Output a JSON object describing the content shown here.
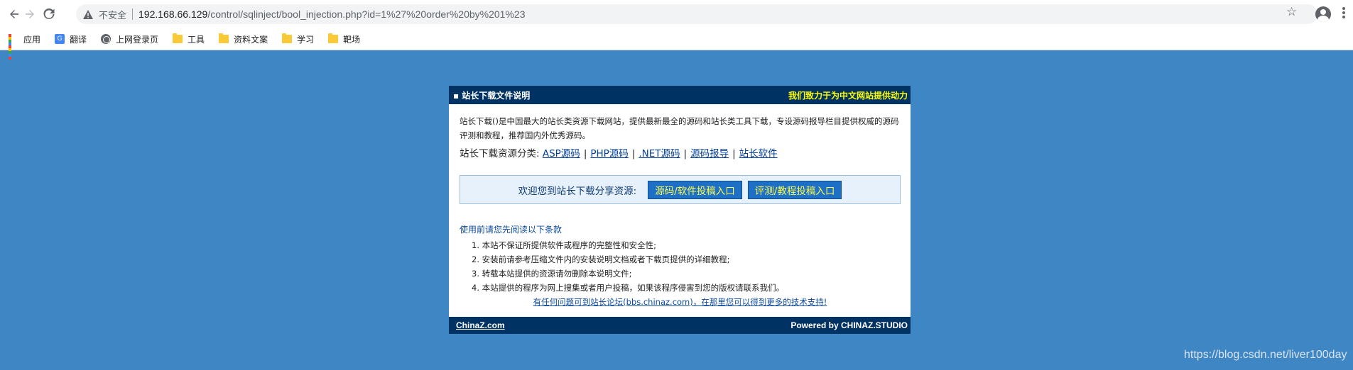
{
  "browser": {
    "security_label": "不安全",
    "url_host": "192.168.66.129",
    "url_path": "/control/sqlinject/bool_injection.php?id=1%27%20order%20by%201%23",
    "bookmarks": [
      "应用",
      "翻译",
      "上网登录页",
      "工具",
      "资料文案",
      "学习",
      "靶场"
    ],
    "icons": [
      "back-icon",
      "forward-icon",
      "reload-icon",
      "warning-icon",
      "star-icon",
      "account-icon",
      "menu-icon"
    ]
  },
  "panel": {
    "title": "▪ 站长下载文件说明",
    "slogan": "我们致力于为中文网站提供动力",
    "intro": "站长下载()是中国最大的站长类资源下载网站，提供最新最全的源码和站长类工具下载，专设源码报导栏目提供权威的源码评测和教程，推荐国内外优秀源码。",
    "category_label": "站长下载资源分类:",
    "categories": [
      "ASP源码",
      "PHP源码",
      ".NET源码",
      "源码报导",
      "站长软件"
    ],
    "share_text": "欢迎您到站长下载分享资源:",
    "share_buttons": [
      "源码/软件投稿入口",
      "评测/教程投稿入口"
    ],
    "terms_heading": "使用前请您先阅读以下条款",
    "terms": [
      "1. 本站不保证所提供软件或程序的完整性和安全性;",
      "2. 安装前请参考压缩文件内的安装说明文档或者下载页提供的详细教程;",
      "3. 转载本站提供的资源请勿删除本说明文件;",
      "4. 本站提供的程序为网上搜集或者用户投稿，如果该程序侵害到您的版权请联系我们。"
    ],
    "support_link": "有任何问题可到站长论坛(bbs.chinaz.com)，在那里您可以得到更多的技术支持!",
    "footer_left": "ChinaZ.com",
    "footer_right": "Powered by CHINAZ.STUDIO"
  },
  "watermark": "https://blog.csdn.net/liver100day",
  "colors": {
    "page_background": "#3f86c4",
    "panel_header": "#003263",
    "slogan": "#ffff00",
    "button": "#1e6fc6"
  }
}
